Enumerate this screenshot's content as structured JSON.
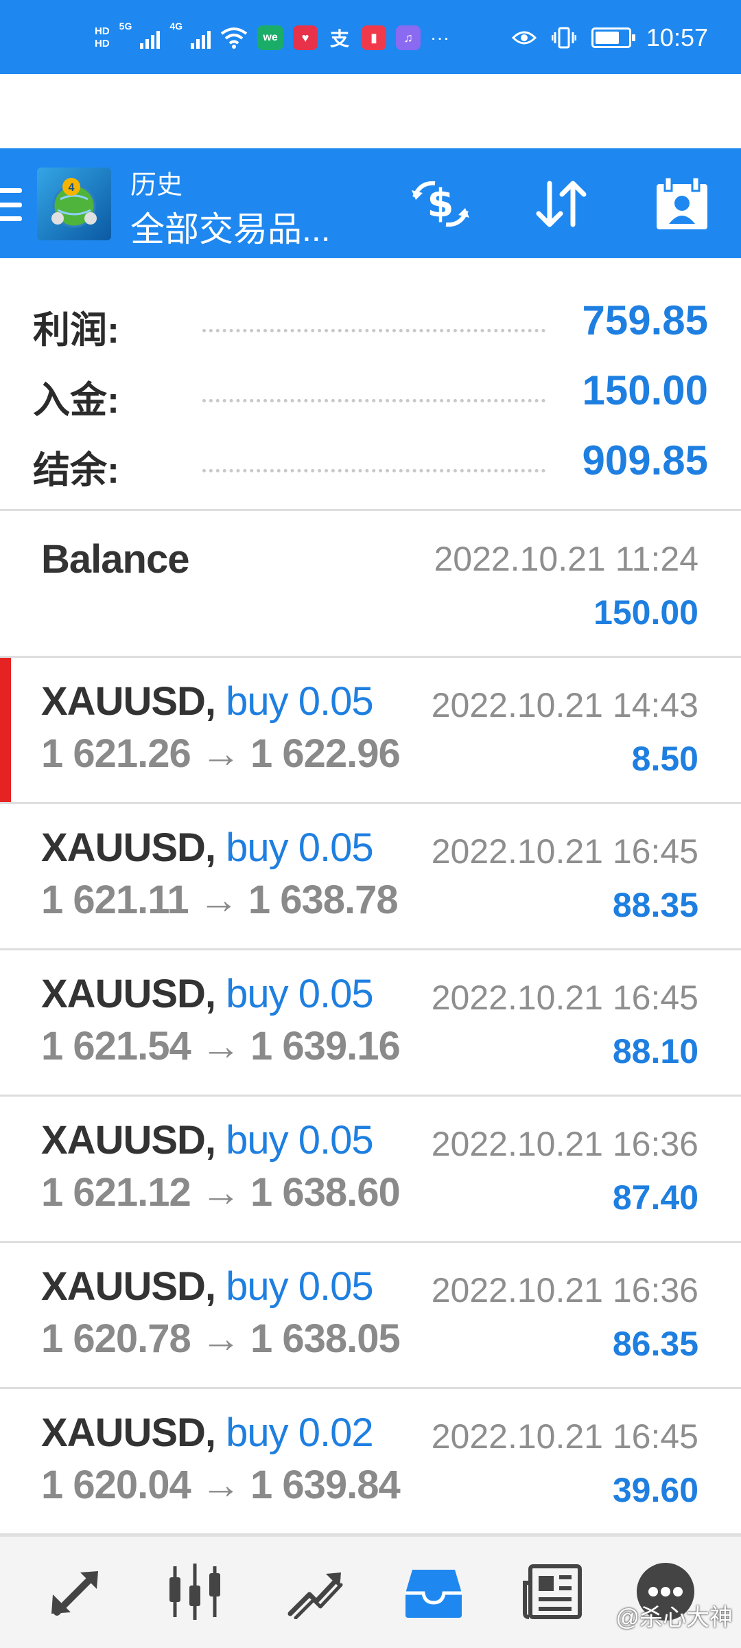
{
  "status_bar": {
    "hd1": "HD",
    "hd2": "HD",
    "sim1_tag": "5G",
    "sim2_tag": "4G",
    "apps": [
      "we",
      "支"
    ],
    "more": "···",
    "time": "10:57"
  },
  "toolbar": {
    "subtitle": "历史",
    "title": "全部交易品..."
  },
  "summary": {
    "rows": [
      {
        "label": "利润:",
        "value": "759.85"
      },
      {
        "label": "入金:",
        "value": "150.00"
      },
      {
        "label": "结余:",
        "value": "909.85"
      }
    ]
  },
  "balance": {
    "title": "Balance",
    "time": "2022.10.21 11:24",
    "amount": "150.00"
  },
  "deals": [
    {
      "symbol": "XAUUSD,",
      "side": "buy 0.05",
      "time": "2022.10.21 14:43",
      "open": "1 621.26",
      "close": "1 622.96",
      "profit": "8.50",
      "highlighted": true
    },
    {
      "symbol": "XAUUSD,",
      "side": "buy 0.05",
      "time": "2022.10.21 16:45",
      "open": "1 621.11",
      "close": "1 638.78",
      "profit": "88.35",
      "highlighted": false
    },
    {
      "symbol": "XAUUSD,",
      "side": "buy 0.05",
      "time": "2022.10.21 16:45",
      "open": "1 621.54",
      "close": "1 639.16",
      "profit": "88.10",
      "highlighted": false
    },
    {
      "symbol": "XAUUSD,",
      "side": "buy 0.05",
      "time": "2022.10.21 16:36",
      "open": "1 621.12",
      "close": "1 638.60",
      "profit": "87.40",
      "highlighted": false
    },
    {
      "symbol": "XAUUSD,",
      "side": "buy 0.05",
      "time": "2022.10.21 16:36",
      "open": "1 620.78",
      "close": "1 638.05",
      "profit": "86.35",
      "highlighted": false
    },
    {
      "symbol": "XAUUSD,",
      "side": "buy 0.02",
      "time": "2022.10.21 16:45",
      "open": "1 620.04",
      "close": "1 639.84",
      "profit": "39.60",
      "highlighted": false
    }
  ],
  "arrow": "→",
  "bottom_nav": {
    "items": [
      "quotes-icon",
      "chart-icon",
      "trade-icon",
      "history-icon",
      "news-icon",
      "chat-icon"
    ],
    "active": "history-icon"
  },
  "watermark": "@杀心大神",
  "colors": {
    "accent": "#1e88f0",
    "value_blue": "#1e7fe0",
    "marker_red": "#e52323"
  }
}
